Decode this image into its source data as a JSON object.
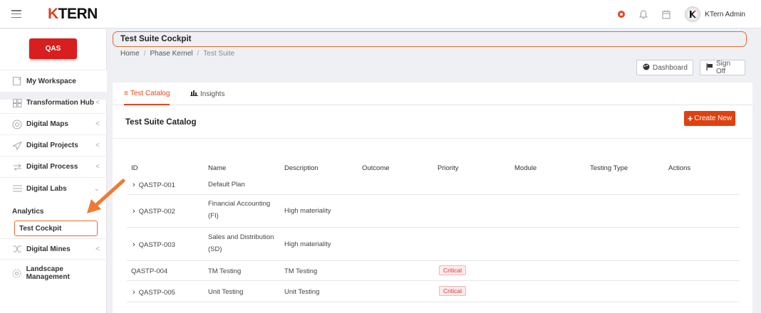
{
  "header": {
    "logo": "TERN",
    "logo_k": "K",
    "user_name": "KTern Admin"
  },
  "sidebar": {
    "env_button": "QAS",
    "items": [
      {
        "label": "My Workspace",
        "icon": "workspace-icon",
        "chevron": false
      },
      {
        "label": "Transformation Hub",
        "icon": "grid-icon",
        "chevron": true
      },
      {
        "label": "Digital Maps",
        "icon": "map-icon",
        "chevron": true
      },
      {
        "label": "Digital Projects",
        "icon": "send-icon",
        "chevron": true
      },
      {
        "label": "Digital Process",
        "icon": "process-icon",
        "chevron": true
      },
      {
        "label": "Digital Labs",
        "icon": "list-icon",
        "chevron": true,
        "expanded": true
      },
      {
        "label": "Digital Mines",
        "icon": "mines-icon",
        "chevron": true
      },
      {
        "label": "Landscape Management",
        "icon": "gear-icon",
        "chevron": false
      }
    ],
    "sub_items": [
      "Analytics",
      "Test Cockpit"
    ]
  },
  "page": {
    "title": "Test Suite Cockpit",
    "breadcrumb": [
      "Home",
      "Phase Kernel",
      "Test Suite"
    ],
    "dashboard_btn": "Dashboard",
    "signoff_btn": "Sign Off"
  },
  "tabs": [
    "Test Catalog",
    "Insights"
  ],
  "catalog": {
    "title": "Test Suite Catalog",
    "create_btn": "Create New",
    "columns": [
      "ID",
      "Name",
      "Description",
      "Outcome",
      "Priority",
      "Module",
      "Testing Type",
      "Actions"
    ],
    "rows": [
      {
        "id": "QASTP-001",
        "name": [
          "Default Plan"
        ],
        "description": "",
        "priority": "",
        "expandable": true
      },
      {
        "id": "QASTP-002",
        "name": [
          "Financial Accounting",
          "(FI)"
        ],
        "description": "High materiality",
        "priority": "",
        "expandable": true
      },
      {
        "id": "QASTP-003",
        "name": [
          "Sales and Distribution",
          "(SD)"
        ],
        "description": "High materiality",
        "priority": "",
        "expandable": true
      },
      {
        "id": "QASTP-004",
        "name": [
          "TM Testing"
        ],
        "description": "TM Testing",
        "priority": "Critical",
        "expandable": false
      },
      {
        "id": "QASTP-005",
        "name": [
          "Unit Testing"
        ],
        "description": "Unit Testing",
        "priority": "Critical",
        "expandable": true
      }
    ]
  },
  "colors": {
    "accent": "#e8461c",
    "qas": "#d81e1e",
    "highlight": "#e8692e"
  }
}
